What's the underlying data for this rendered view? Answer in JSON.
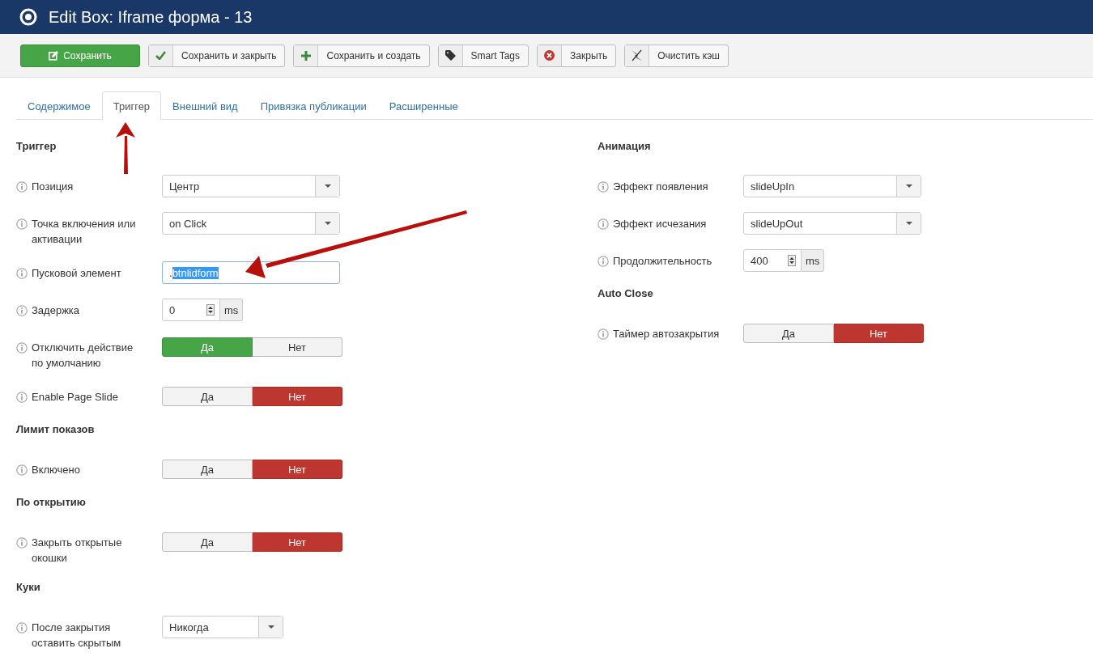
{
  "header": {
    "title": "Edit Box: Iframe форма - 13"
  },
  "toolbar": [
    {
      "kind": "save",
      "label": "Сохранить"
    },
    {
      "kind": "apply",
      "label": "Сохранить и закрыть"
    },
    {
      "kind": "new",
      "label": "Сохранить и создать"
    },
    {
      "kind": "tags",
      "label": "Smart Tags"
    },
    {
      "kind": "close",
      "label": "Закрыть"
    },
    {
      "kind": "cache",
      "label": "Очистить кэш"
    }
  ],
  "tabs": [
    {
      "label": "Содержимое",
      "selected": false
    },
    {
      "label": "Триггер",
      "selected": true
    },
    {
      "label": "Внешний вид",
      "selected": false
    },
    {
      "label": "Привязка публикации",
      "selected": false
    },
    {
      "label": "Расширенные",
      "selected": false
    }
  ],
  "columns": [
    {
      "sections": [
        {
          "title": "Триггер",
          "fields": [
            {
              "kind": "select",
              "label": "Позиция",
              "value": "Центр"
            },
            {
              "kind": "select",
              "label": "Точка включения или активации",
              "value": "on Click"
            },
            {
              "kind": "text",
              "label": "Пусковой элемент",
              "value": [
                {
                  "text": ".",
                  "selected": false
                },
                {
                  "text": "btnlidform",
                  "selected": true
                }
              ]
            },
            {
              "kind": "number",
              "label": "Задержка",
              "value": "0",
              "unit": "ms"
            },
            {
              "kind": "toggle",
              "label": "Отключить действие по умолчанию",
              "options": [
                {
                  "label": "Да",
                  "selected": true
                },
                {
                  "label": "Нет",
                  "selected": false
                }
              ]
            },
            {
              "kind": "toggle",
              "label": "Enable Page Slide",
              "options": [
                {
                  "label": "Да",
                  "selected": false
                },
                {
                  "label": "Нет",
                  "selected": true
                }
              ]
            }
          ]
        },
        {
          "title": "Лимит показов",
          "fields": [
            {
              "kind": "toggle",
              "label": "Включено",
              "options": [
                {
                  "label": "Да",
                  "selected": false
                },
                {
                  "label": "Нет",
                  "selected": true
                }
              ]
            }
          ]
        },
        {
          "title": "По открытию",
          "fields": [
            {
              "kind": "toggle",
              "label": "Закрыть открытые окошки",
              "options": [
                {
                  "label": "Да",
                  "selected": false
                },
                {
                  "label": "Нет",
                  "selected": true
                }
              ]
            }
          ]
        },
        {
          "title": "Куки",
          "fields": [
            {
              "kind": "select-short",
              "label": "После закрытия оставить скрытым",
              "value": "Никогда"
            }
          ]
        }
      ]
    },
    {
      "sections": [
        {
          "title": "Анимация",
          "fields": [
            {
              "kind": "select",
              "label": "Эффект появления",
              "value": "slideUpIn"
            },
            {
              "kind": "select",
              "label": "Эффект исчезания",
              "value": "slideUpOut"
            },
            {
              "kind": "number",
              "label": "Продолжительность",
              "value": "400",
              "unit": "ms"
            }
          ]
        },
        {
          "title": "Auto Close",
          "fields": [
            {
              "kind": "toggle",
              "label": "Таймер автозакрытия",
              "options": [
                {
                  "label": "Да",
                  "selected": false
                },
                {
                  "label": "Нет",
                  "selected": true
                }
              ]
            }
          ]
        }
      ]
    }
  ]
}
